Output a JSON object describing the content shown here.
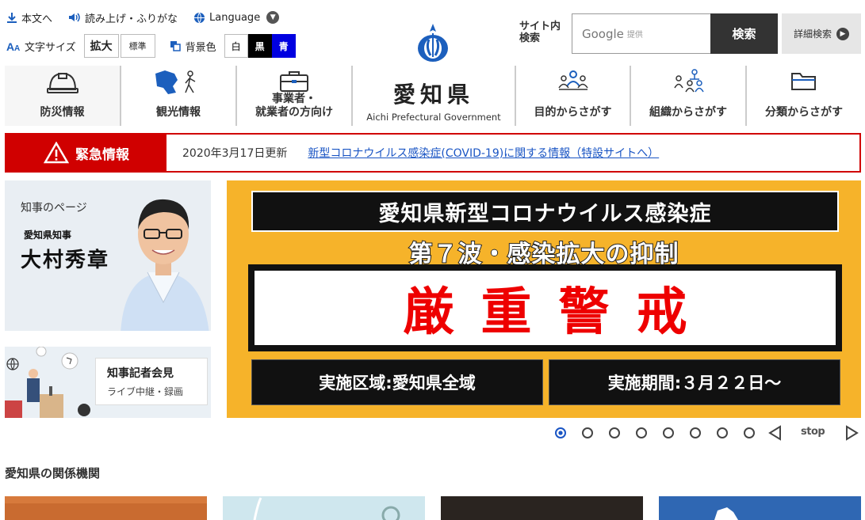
{
  "util": {
    "skip_link": "本文へ",
    "read_aloud": "読み上げ・ふりがな",
    "language": "Language",
    "font_size_label": "文字サイズ",
    "font_size_large": "拡大",
    "font_size_standard": "標準",
    "bg_color_label": "背景色",
    "bg_white": "白",
    "bg_black": "黒",
    "bg_blue": "青"
  },
  "search": {
    "label_line1": "サイト内",
    "label_line2": "検索",
    "placeholder_brand": "Google",
    "placeholder_provider": "提供",
    "button": "検索",
    "advanced": "詳細検索"
  },
  "logo": {
    "name_jp": "愛知県",
    "name_en": "Aichi Prefectural Government"
  },
  "gnav": {
    "disaster": "防災情報",
    "tourism": "観光情報",
    "business_line1": "事業者・",
    "business_line2": "就業者の方向け",
    "purpose": "目的からさがす",
    "organization": "組織からさがす",
    "category": "分類からさがす"
  },
  "emergency": {
    "label": "緊急情報",
    "date": "2020年3月17日更新",
    "link": "新型コロナウイルス感染症(COVID-19)に関する情報（特設サイトへ）"
  },
  "governor": {
    "title": "知事のページ",
    "subtitle": "愛知県知事",
    "name": "大村秀章"
  },
  "press": {
    "title": "知事記者会見",
    "subtitle": "ライブ中継・録画"
  },
  "slide": {
    "title": "愛知県新型コロナウイルス感染症",
    "subtitle": "第７波・感染拡大の抑制",
    "alert": "厳重警戒",
    "area": "実施区域:愛知県全域",
    "period": "実施期間:３月２２日～",
    "stop_label": "stop",
    "dot_count": 8,
    "active_dot": 1
  },
  "related": {
    "title": "愛知県の関係機関"
  },
  "colors": {
    "emergency_red": "#d00000",
    "link_blue": "#1a55c4",
    "logo_blue": "#1c5fbd",
    "slide_orange": "#f6b32a"
  }
}
